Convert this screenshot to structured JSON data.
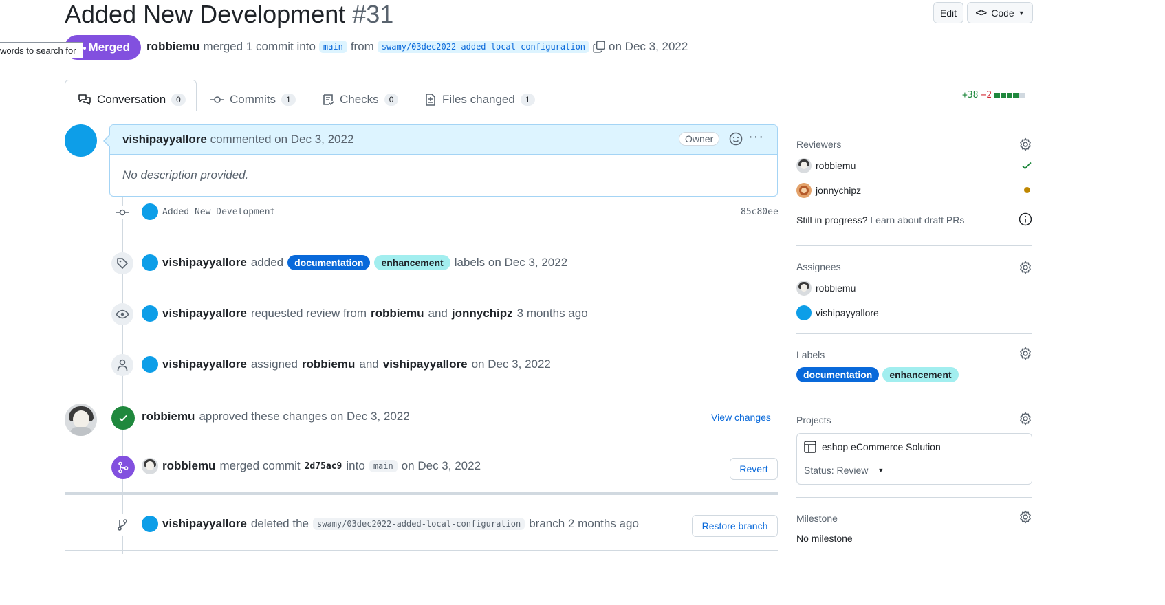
{
  "header": {
    "title": "Added New Development",
    "number": "#31",
    "edit_label": "Edit",
    "code_label": "Code",
    "status_badge": "Merged",
    "tooltip": "words to search for",
    "author": "robbiemu",
    "merged_text": "merged 1 commit into",
    "base_branch": "main",
    "from_text": "from",
    "head_branch": "swamy/03dec2022-added-local-configuration",
    "date_text": "on Dec 3, 2022"
  },
  "tabs": [
    {
      "label": "Conversation",
      "count": "0"
    },
    {
      "label": "Commits",
      "count": "1"
    },
    {
      "label": "Checks",
      "count": "0"
    },
    {
      "label": "Files changed",
      "count": "1"
    }
  ],
  "diffstat": {
    "additions": "+38",
    "deletions": "−2"
  },
  "comment": {
    "author": "vishipayyallore",
    "action": "commented on Dec 3, 2022",
    "role": "Owner",
    "body": "No description provided."
  },
  "timeline": {
    "commit": {
      "message": "Added New Development",
      "sha": "85c80ee"
    },
    "labels_event": {
      "actor": "vishipayyallore",
      "verb": "added",
      "labels": [
        "documentation",
        "enhancement"
      ],
      "suffix": "labels on Dec 3, 2022"
    },
    "review_request": {
      "actor": "vishipayyallore",
      "verb": "requested review from",
      "user1": "robbiemu",
      "and": "and",
      "user2": "jonnychipz",
      "time": "3 months ago"
    },
    "assign": {
      "actor": "vishipayyallore",
      "verb": "assigned",
      "user1": "robbiemu",
      "and": "and",
      "user2": "vishipayyallore",
      "time": "on Dec 3, 2022"
    },
    "approve": {
      "actor": "robbiemu",
      "text": "approved these changes on Dec 3, 2022",
      "link": "View changes"
    },
    "merge": {
      "actor": "robbiemu",
      "verb": "merged commit",
      "sha": "2d75ac9",
      "into": "into",
      "branch": "main",
      "time": "on Dec 3, 2022",
      "button": "Revert"
    },
    "delete": {
      "actor": "vishipayyallore",
      "verb": "deleted the",
      "branch": "swamy/03dec2022-added-local-configuration",
      "suffix": "branch 2 months ago",
      "button": "Restore branch"
    }
  },
  "sidebar": {
    "reviewers": {
      "title": "Reviewers",
      "items": [
        {
          "name": "robbiemu",
          "status": "approved"
        },
        {
          "name": "jonnychipz",
          "status": "pending"
        }
      ],
      "draft_q": "Still in progress?",
      "draft_link": "Learn about draft PRs"
    },
    "assignees": {
      "title": "Assignees",
      "items": [
        "robbiemu",
        "vishipayyallore"
      ]
    },
    "labels": {
      "title": "Labels",
      "items": [
        "documentation",
        "enhancement"
      ]
    },
    "projects": {
      "title": "Projects",
      "name": "eshop eCommerce Solution",
      "status": "Status: Review"
    },
    "milestone": {
      "title": "Milestone",
      "value": "No milestone"
    }
  },
  "colors": {
    "merged": "#8250df",
    "link": "#0969da",
    "approved": "#1f883d",
    "pending": "#bf8700",
    "avatar": "#0d9ee8"
  }
}
